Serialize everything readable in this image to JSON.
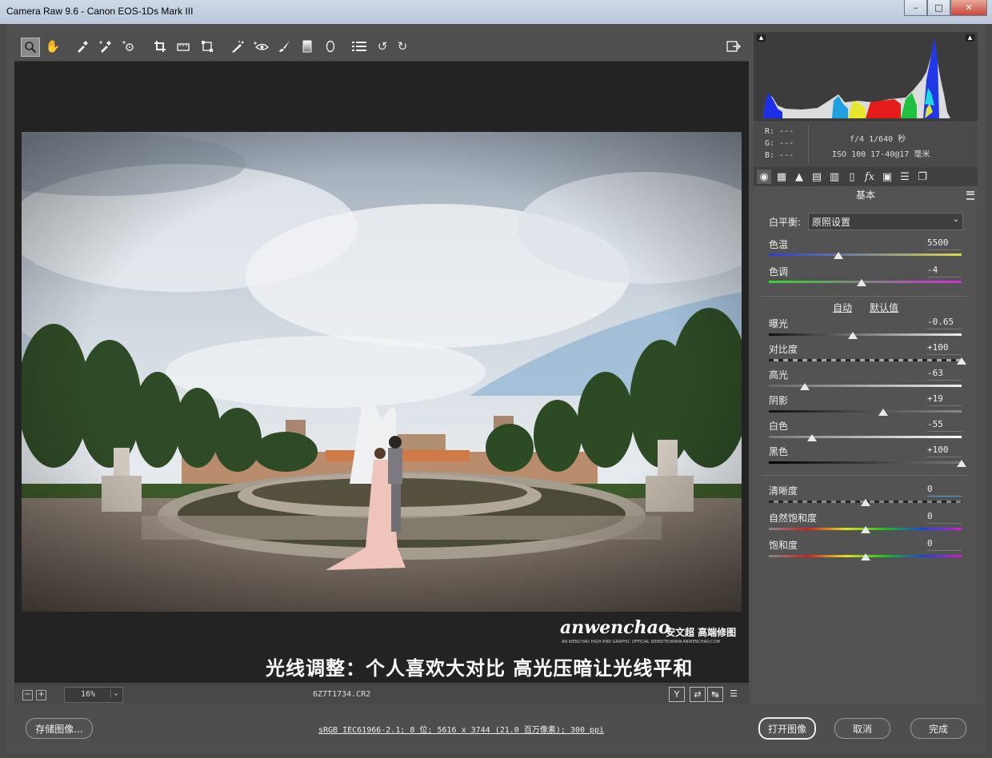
{
  "window": {
    "title": "Camera Raw 9.6 -  Canon EOS-1Ds Mark III",
    "min": "–",
    "max": "□",
    "close": "✕"
  },
  "toolbar": {
    "tools": [
      "zoom-icon",
      "hand-icon",
      "white-balance-icon",
      "color-sampler-icon",
      "targeted-adjust-icon",
      "crop-icon",
      "straighten-icon",
      "transform-icon",
      "spot-removal-icon",
      "red-eye-icon",
      "adjustment-brush-icon",
      "graduated-filter-icon",
      "radial-filter-icon",
      "preferences-icon",
      "rotate-left-icon",
      "rotate-right-icon"
    ],
    "fullscreen": "fullscreen-icon"
  },
  "preview": {
    "watermark": {
      "logo": "anwenchao",
      "cn": "安文超 高端修图",
      "sub": "AN WENCHAO HIGH-END GRAPHIC OFFICIAL WEBSITE/WWW.ANWENCHAO.COM"
    },
    "caption": "光线调整：个人喜欢大对比 高光压暗让光线平和"
  },
  "status": {
    "minus": "−",
    "plus": "+",
    "zoom": "16%",
    "zoom_caret": "⌄",
    "filename": "6Z7T1734.CR2",
    "btn_y": "Y",
    "btn_swap": "⇄",
    "btn_arrow": "↹",
    "btn_settings": "☰"
  },
  "histogram": {
    "left_clip": "▲",
    "right_clip": "▲"
  },
  "metadata": {
    "r": "R:  ---",
    "g": "G:  ---",
    "b": "B:  ---",
    "line1": "f/4   1/640 秒",
    "line2": "ISO 100   17-40@17 毫米"
  },
  "panel_tabs": [
    "basic-icon",
    "tone-curve-icon",
    "detail-icon",
    "hsl-icon",
    "split-toning-icon",
    "lens-icon",
    "fx-icon",
    "camera-calibration-icon",
    "presets-icon",
    "snapshots-icon"
  ],
  "basic": {
    "heading": "基本",
    "wb_label": "白平衡:",
    "wb_value": "原照设置",
    "wb_caret": "⌄",
    "auto": "自动",
    "default": "默认值",
    "sliders": {
      "temp": {
        "label": "色温",
        "value": "5500",
        "position": 0.36
      },
      "tint": {
        "label": "色调",
        "value": "-4",
        "position": 0.48
      },
      "exposure": {
        "label": "曝光",
        "value": "-0.65",
        "position": 0.435
      },
      "contrast": {
        "label": "对比度",
        "value": "+100",
        "position": 1.0
      },
      "highlights": {
        "label": "高光",
        "value": "-63",
        "position": 0.185
      },
      "shadows": {
        "label": "阴影",
        "value": "+19",
        "position": 0.595
      },
      "whites": {
        "label": "白色",
        "value": "-55",
        "position": 0.225
      },
      "blacks": {
        "label": "黑色",
        "value": "+100",
        "position": 1.0
      },
      "clarity": {
        "label": "清晰度",
        "value": "0",
        "position": 0.5
      },
      "vibrance": {
        "label": "自然饱和度",
        "value": "0",
        "position": 0.5
      },
      "saturation": {
        "label": "饱和度",
        "value": "0",
        "position": 0.5
      }
    }
  },
  "footer": {
    "save": "存储图像...",
    "workflow": "sRGB IEC61966-2.1; 8 位; 5616 x 3744 (21.0 百万像素); 300 ppi",
    "open": "打开图像",
    "cancel": "取消",
    "done": "完成"
  }
}
